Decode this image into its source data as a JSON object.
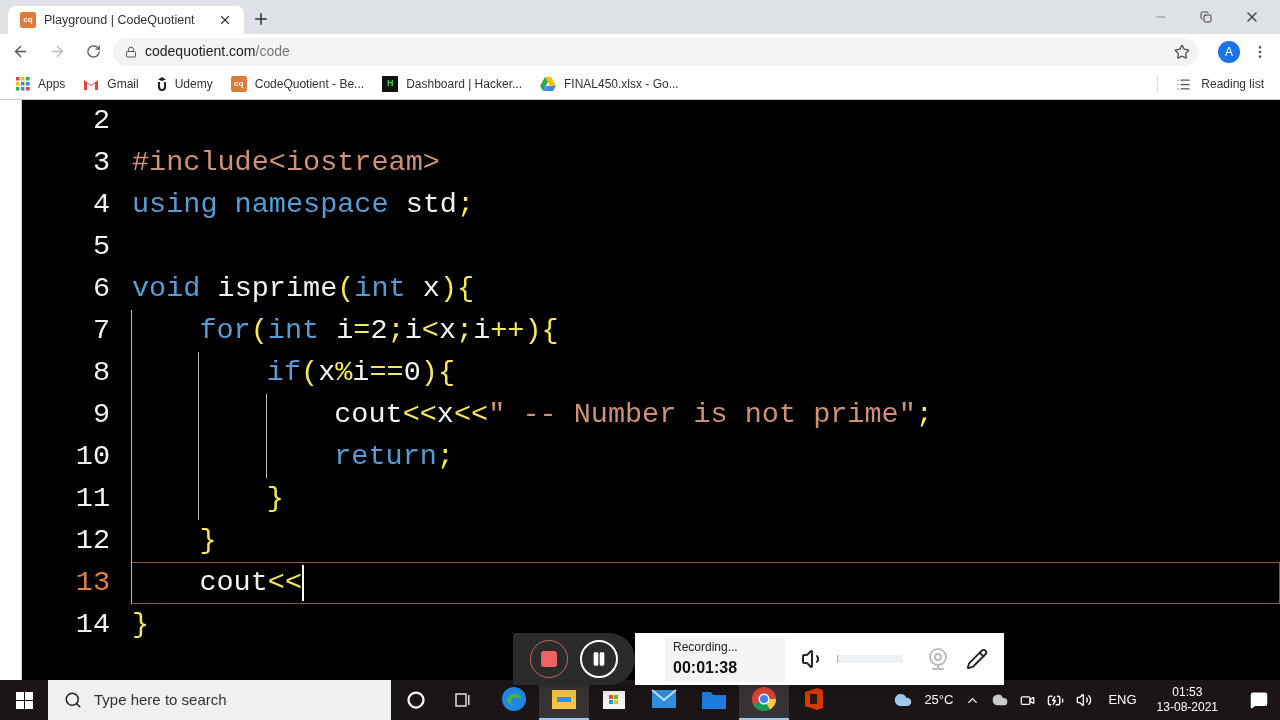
{
  "browser": {
    "tab": {
      "title": "Playground | CodeQuotient",
      "favicon": "cq"
    },
    "url": {
      "host": "codequotient.com",
      "path": "/code"
    },
    "profile": "A",
    "bookmarks": [
      {
        "label": "Apps"
      },
      {
        "label": "Gmail"
      },
      {
        "label": "Udemy"
      },
      {
        "label": "CodeQuotient - Be...",
        "logo_text": "cq"
      },
      {
        "label": "Dashboard | Hacker...",
        "logo_text": "H"
      },
      {
        "label": "FINAL450.xlsx - Go..."
      }
    ],
    "reading_list": "Reading list"
  },
  "editor": {
    "lines": [
      {
        "number": "2",
        "active": false
      },
      {
        "number": "3",
        "active": false,
        "tokens": [
          {
            "kind": "str",
            "text": "#include<iostream>"
          }
        ]
      },
      {
        "number": "4",
        "active": false,
        "tokens": [
          {
            "kind": "kw",
            "text": "using"
          },
          {
            "kind": "kw",
            "text": " namespace"
          },
          {
            "kind": "id",
            "text": " std"
          },
          {
            "kind": "op",
            "text": ";"
          }
        ]
      },
      {
        "number": "5",
        "active": false
      },
      {
        "number": "6",
        "active": false,
        "tokens": [
          {
            "kind": "kw",
            "text": "void"
          },
          {
            "kind": "id",
            "text": " isprime"
          },
          {
            "kind": "op",
            "text": "("
          },
          {
            "kind": "kw",
            "text": "int"
          },
          {
            "kind": "id",
            "text": " x"
          },
          {
            "kind": "op",
            "text": "){"
          }
        ]
      },
      {
        "number": "7",
        "active": false,
        "tokens": [
          {
            "kind": "kw",
            "text": "    for"
          },
          {
            "kind": "op",
            "text": "("
          },
          {
            "kind": "kw",
            "text": "int"
          },
          {
            "kind": "id",
            "text": " i"
          },
          {
            "kind": "op",
            "text": "="
          },
          {
            "kind": "id",
            "text": "2"
          },
          {
            "kind": "op",
            "text": ";"
          },
          {
            "kind": "id",
            "text": "i"
          },
          {
            "kind": "op",
            "text": "<"
          },
          {
            "kind": "id",
            "text": "x"
          },
          {
            "kind": "op",
            "text": ";"
          },
          {
            "kind": "id",
            "text": "i"
          },
          {
            "kind": "op",
            "text": "++){"
          }
        ]
      },
      {
        "number": "8",
        "active": false,
        "tokens": [
          {
            "kind": "kw",
            "text": "        if"
          },
          {
            "kind": "op",
            "text": "("
          },
          {
            "kind": "id",
            "text": "x"
          },
          {
            "kind": "op",
            "text": "%"
          },
          {
            "kind": "id",
            "text": "i"
          },
          {
            "kind": "op",
            "text": "=="
          },
          {
            "kind": "id",
            "text": "0"
          },
          {
            "kind": "op",
            "text": "){"
          }
        ]
      },
      {
        "number": "9",
        "active": false,
        "tokens": [
          {
            "kind": "id",
            "text": "            cout"
          },
          {
            "kind": "op",
            "text": "<<"
          },
          {
            "kind": "id",
            "text": "x"
          },
          {
            "kind": "op",
            "text": "<<"
          },
          {
            "kind": "str",
            "text": "\" -- Number is not prime\""
          },
          {
            "kind": "op",
            "text": ";"
          }
        ]
      },
      {
        "number": "10",
        "active": false,
        "tokens": [
          {
            "kind": "kw",
            "text": "            return"
          },
          {
            "kind": "op",
            "text": ";"
          }
        ]
      },
      {
        "number": "11",
        "active": false,
        "tokens": [
          {
            "kind": "op",
            "text": "        }"
          }
        ]
      },
      {
        "number": "12",
        "active": false,
        "tokens": [
          {
            "kind": "op",
            "text": "    }"
          }
        ]
      },
      {
        "number": "13",
        "active": true,
        "tokens": [
          {
            "kind": "id",
            "text": "    cout"
          },
          {
            "kind": "op",
            "text": "<<"
          }
        ]
      },
      {
        "number": "14",
        "active": false,
        "tokens": [
          {
            "kind": "op",
            "text": "}"
          }
        ]
      }
    ]
  },
  "recorder": {
    "status": "Recording...",
    "time": "00:01:38",
    "volume": {
      "level": 0.02
    }
  },
  "taskbar": {
    "search_placeholder": "Type here to search",
    "apps": [
      {
        "active": false
      },
      {
        "active": true
      },
      {
        "active": false
      },
      {
        "active": false
      },
      {
        "active": false
      },
      {
        "active": true
      },
      {
        "active": false
      }
    ],
    "temperature": "25°C",
    "language": "ENG",
    "time": "01:53",
    "date": "13-08-2021"
  }
}
